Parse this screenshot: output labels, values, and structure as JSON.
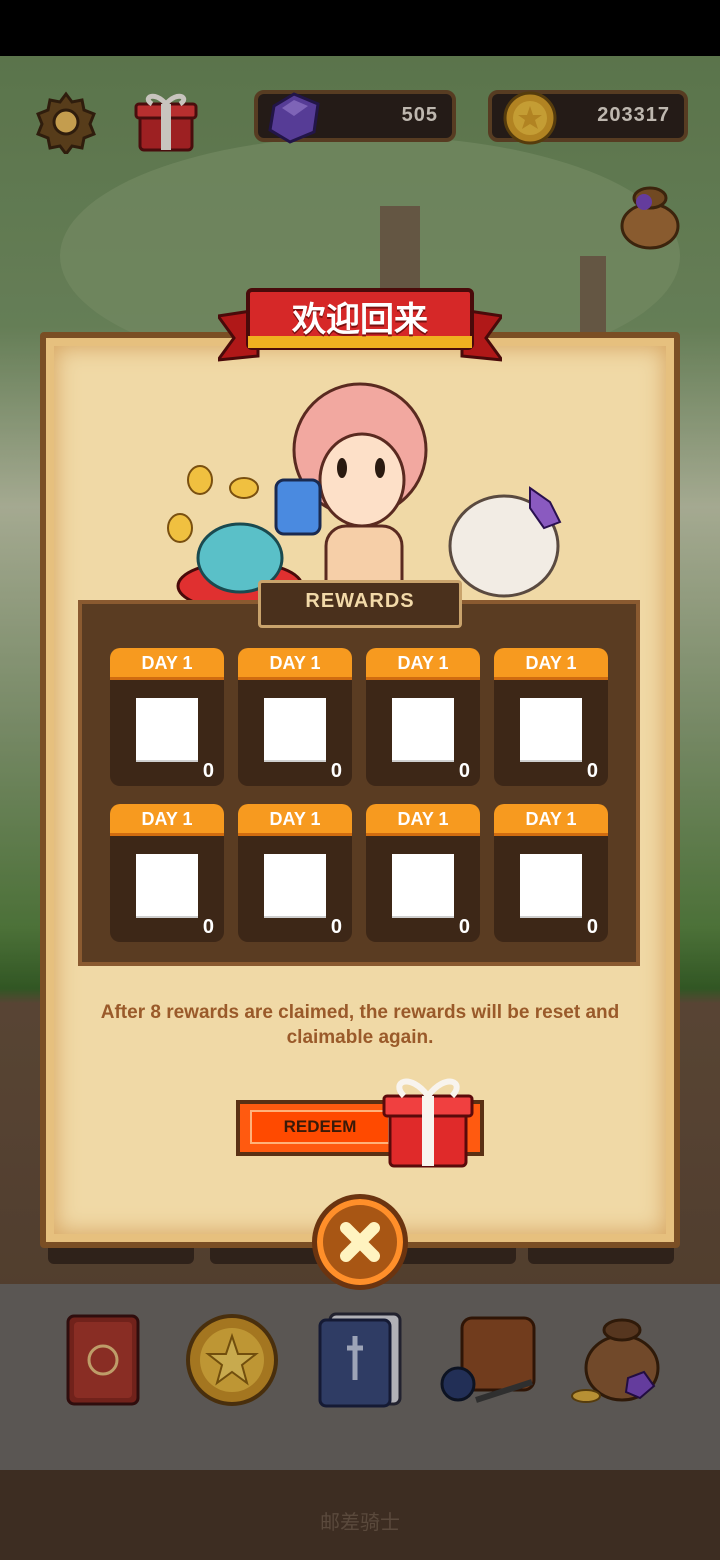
{
  "hud": {
    "gems": "505",
    "gold": "203317",
    "icons": [
      "gear-icon",
      "gift-box-icon",
      "gem-icon",
      "coin-icon",
      "money-bag-icon"
    ]
  },
  "dialog": {
    "title": "欢迎回来",
    "rewards_label": "REWARDS",
    "cards": [
      {
        "day": "DAY 1",
        "qty": "0"
      },
      {
        "day": "DAY 1",
        "qty": "0"
      },
      {
        "day": "DAY 1",
        "qty": "0"
      },
      {
        "day": "DAY 1",
        "qty": "0"
      },
      {
        "day": "DAY 1",
        "qty": "0"
      },
      {
        "day": "DAY 1",
        "qty": "0"
      },
      {
        "day": "DAY 1",
        "qty": "0"
      },
      {
        "day": "DAY 1",
        "qty": "0"
      }
    ],
    "info": "After 8 rewards are claimed, the rewards will be reset and claimable again.",
    "redeem": "REDEEM",
    "close_icon": "close-x-icon"
  },
  "dock": {
    "items": [
      "book-icon",
      "star-coin-icon",
      "card-deck-icon",
      "backpack-icon",
      "treasure-bag-icon"
    ]
  },
  "footer": "邮差骑士",
  "colors": {
    "accent_orange": "#f79a1f",
    "ribbon_red": "#d62828",
    "parchment": "#f0d9a6",
    "panel_brown": "#5a3c22"
  }
}
